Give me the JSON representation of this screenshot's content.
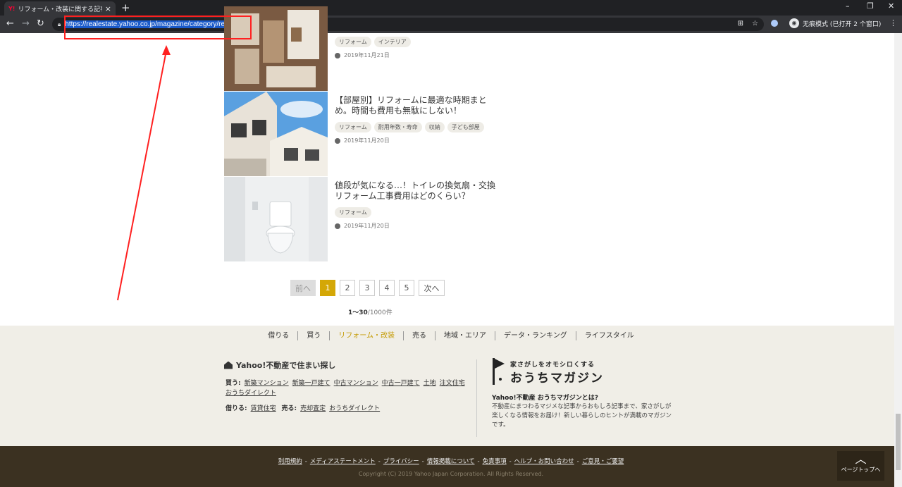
{
  "browser": {
    "tab_title": "リフォーム・改装に関する記事",
    "tab_favicon": "Y!",
    "tab_close": "×",
    "new_tab": "+",
    "url": "https://realestate.yahoo.co.jp/magazine/category/reform",
    "incognito_label": "无痕模式 (已打开 2 个窗口)",
    "icons": [
      "back-icon",
      "forward-icon",
      "reload-icon",
      "lock-icon",
      "translate-icon",
      "star-icon",
      "profile-icon",
      "incognito-icon",
      "menu-icon"
    ]
  },
  "articles": [
    {
      "title": "",
      "tags": [
        "リフォーム",
        "インテリア"
      ],
      "date": "2019年11月21日"
    },
    {
      "title": "【部屋別】リフォームに最適な時期まとめ。時間も費用も無駄にしない！",
      "tags": [
        "リフォーム",
        "耐用年数・寿命",
        "収納",
        "子ども部屋"
      ],
      "date": "2019年11月20日"
    },
    {
      "title": "値段が気になる…！トイレの換気扇・交換リフォーム工事費用はどのくらい？",
      "tags": [
        "リフォーム"
      ],
      "date": "2019年11月20日"
    }
  ],
  "pagination": {
    "prev": "前へ",
    "pages": [
      "1",
      "2",
      "3",
      "4",
      "5"
    ],
    "current": "1",
    "next": "次へ",
    "range": "1〜30",
    "total": "/1000件"
  },
  "footer": {
    "nav": [
      "借りる",
      "買う",
      "リフォーム・改装",
      "売る",
      "地域・エリア",
      "データ・ランキング",
      "ライフスタイル"
    ],
    "nav_current": "リフォーム・改装",
    "section_title": "Yahoo!不動産で住まい探し",
    "buy_label": "買う:",
    "buy_links": [
      "新築マンション",
      "新築一戸建て",
      "中古マンション",
      "中古一戸建て",
      "土地",
      "注文住宅",
      "おうちダイレクト"
    ],
    "rent_label": "借りる:",
    "rent_links": [
      "賃貸住宅"
    ],
    "sell_label": "売る:",
    "sell_links": [
      "売却査定",
      "おうちダイレクト"
    ],
    "mag_sub": "家さがしをオモシロくする",
    "mag_name": "おうちマガジン",
    "mag_question": "Yahoo!不動産 おうちマガジンとは?",
    "mag_desc": "不動産にまつわるマジメな記事からおもしろ記事まで、家さがしが楽しくなる情報をお届け！新しい暮らしのヒントが満載のマガジンです。",
    "bottom_links": [
      "利用規約",
      "メディアステートメント",
      "プライバシー",
      "情報掲載について",
      "免責事項",
      "ヘルプ・お問い合わせ",
      "ご意見・ご要望"
    ],
    "copyright": "Copyright (C) 2019 Yahoo Japan Corporation. All Rights Reserved.",
    "to_top": "ページトップへ"
  },
  "colors": {
    "accent": "#d4a706",
    "annotation": "#ff2020",
    "footer_bg": "#f0eee7",
    "bottom_bg": "#3b3121"
  }
}
